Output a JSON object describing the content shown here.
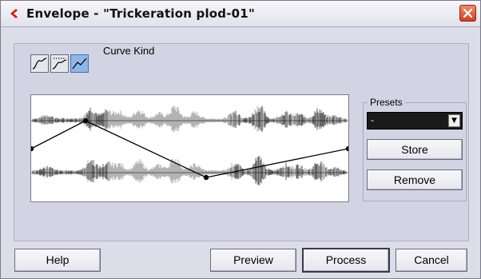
{
  "window": {
    "title": "Envelope - \"Trickeration plod-01\"",
    "close_icon": "close-icon",
    "app_icon": "cubase-logo-icon"
  },
  "curve": {
    "label": "Curve Kind",
    "kinds": [
      {
        "icon": "spline-curve-icon",
        "active": false
      },
      {
        "icon": "damped-spline-curve-icon",
        "active": false
      },
      {
        "icon": "linear-curve-icon",
        "active": true
      }
    ]
  },
  "presets": {
    "label": "Presets",
    "selected": "-",
    "store_label": "Store",
    "remove_label": "Remove"
  },
  "footer": {
    "help_label": "Help",
    "preview_label": "Preview",
    "process_label": "Process",
    "cancel_label": "Cancel"
  },
  "colors": {
    "accent_active": "#8fb6e8",
    "waveform_dark": "#666666",
    "waveform_light": "#b3b3b3",
    "envelope_line": "#000000"
  }
}
